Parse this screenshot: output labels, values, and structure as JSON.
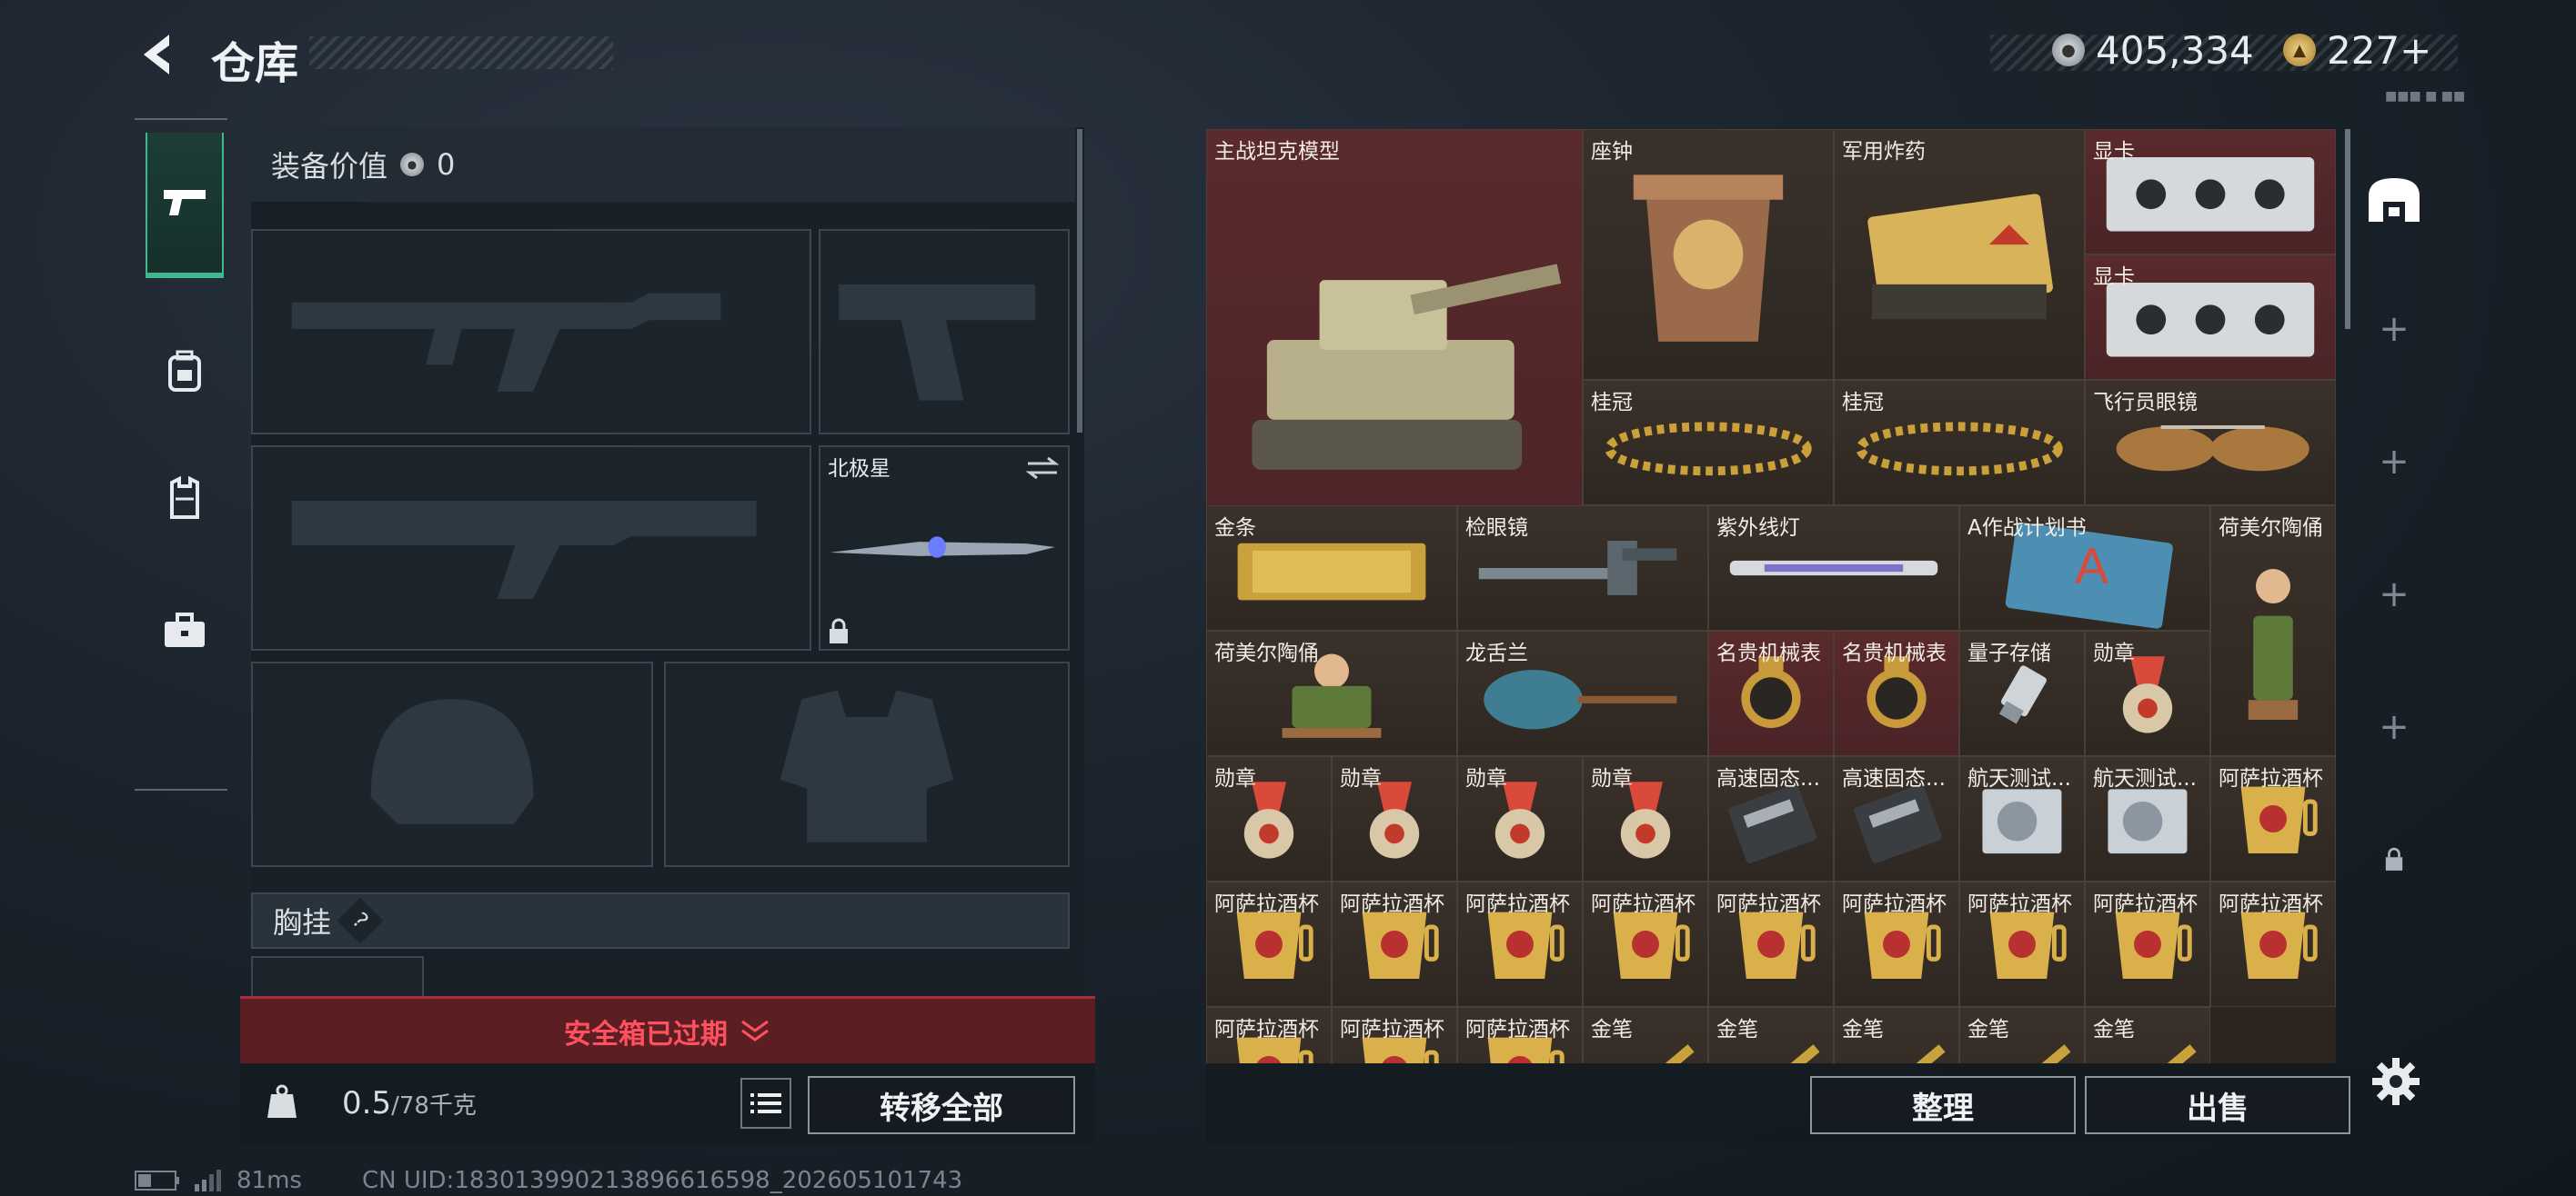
{
  "header": {
    "title": "仓库",
    "silver_amount": "405,334",
    "gold_amount": "227+",
    "sub_label": "■■■ ■ ■■"
  },
  "loadout": {
    "value_label": "装备价值",
    "value_amount": "0",
    "knife_name": "北极星",
    "chest_label": "胸挂",
    "help_mark": "?"
  },
  "safebox": {
    "status": "安全箱已过期"
  },
  "footer": {
    "weight_current": "0.5",
    "weight_max": "/78千克",
    "transfer_all": "转移全部",
    "sort": "整理",
    "sell": "出售",
    "ping": "81ms",
    "uid": "CN UID:18301399021389661659​8_202605101743"
  },
  "items": [
    {
      "name": "主战坦克模型",
      "icon": "tank-icon",
      "rarity": "red"
    },
    {
      "name": "座钟",
      "icon": "clock-icon",
      "rarity": "brown"
    },
    {
      "name": "军用炸药",
      "icon": "explosive-icon",
      "rarity": "brown"
    },
    {
      "name": "显卡",
      "icon": "gpu-icon",
      "rarity": "red"
    },
    {
      "name": "显卡",
      "icon": "gpu-icon",
      "rarity": "red"
    },
    {
      "name": "桂冠",
      "icon": "laurel-icon",
      "rarity": "brown"
    },
    {
      "name": "桂冠",
      "icon": "laurel-icon",
      "rarity": "brown"
    },
    {
      "name": "飞行员眼镜",
      "icon": "sunglasses-icon",
      "rarity": "brown"
    },
    {
      "name": "金条",
      "icon": "gold-bar-icon",
      "rarity": "brown"
    },
    {
      "name": "检眼镜",
      "icon": "ophthalmoscope-icon",
      "rarity": "brown"
    },
    {
      "name": "紫外线灯",
      "icon": "uv-lamp-icon",
      "rarity": "brown"
    },
    {
      "name": "A作战计划书",
      "icon": "plan-book-icon",
      "rarity": "brown"
    },
    {
      "name": "荷美尔陶俑",
      "icon": "figurine-icon",
      "rarity": "brown"
    },
    {
      "name": "荷美尔陶俑",
      "icon": "figurine-icon",
      "rarity": "brown"
    },
    {
      "name": "龙舌兰",
      "icon": "tequila-icon",
      "rarity": "brown"
    },
    {
      "name": "名贵机械表",
      "icon": "watch-icon",
      "rarity": "red"
    },
    {
      "name": "名贵机械表",
      "icon": "watch-icon",
      "rarity": "red"
    },
    {
      "name": "量子存储",
      "icon": "usb-icon",
      "rarity": "brown"
    },
    {
      "name": "勋章",
      "icon": "medal-icon",
      "rarity": "brown"
    },
    {
      "name": "勋章",
      "icon": "medal-icon",
      "rarity": "brown"
    },
    {
      "name": "勋章",
      "icon": "medal-icon",
      "rarity": "brown"
    },
    {
      "name": "勋章",
      "icon": "medal-icon",
      "rarity": "brown"
    },
    {
      "name": "勋章",
      "icon": "medal-icon",
      "rarity": "brown"
    },
    {
      "name": "高速固态...",
      "icon": "ssd-icon",
      "rarity": "brown"
    },
    {
      "name": "高速固态...",
      "icon": "ssd-icon",
      "rarity": "brown"
    },
    {
      "name": "航天测试...",
      "icon": "disk-drive-icon",
      "rarity": "brown"
    },
    {
      "name": "航天测试...",
      "icon": "disk-drive-icon",
      "rarity": "brown"
    },
    {
      "name": "阿萨拉酒杯",
      "icon": "cup-icon",
      "rarity": "brown"
    },
    {
      "name": "阿萨拉酒杯",
      "icon": "cup-icon",
      "rarity": "brown"
    },
    {
      "name": "阿萨拉酒杯",
      "icon": "cup-icon",
      "rarity": "brown"
    },
    {
      "name": "阿萨拉酒杯",
      "icon": "cup-icon",
      "rarity": "brown"
    },
    {
      "name": "阿萨拉酒杯",
      "icon": "cup-icon",
      "rarity": "brown"
    },
    {
      "name": "阿萨拉酒杯",
      "icon": "cup-icon",
      "rarity": "brown"
    },
    {
      "name": "阿萨拉酒杯",
      "icon": "cup-icon",
      "rarity": "brown"
    },
    {
      "name": "阿萨拉酒杯",
      "icon": "cup-icon",
      "rarity": "brown"
    },
    {
      "name": "阿萨拉酒杯",
      "icon": "cup-icon",
      "rarity": "brown"
    },
    {
      "name": "阿萨拉酒杯",
      "icon": "cup-icon",
      "rarity": "brown"
    },
    {
      "name": "阿萨拉酒杯",
      "icon": "cup-icon",
      "rarity": "brown"
    },
    {
      "name": "阿萨拉酒杯",
      "icon": "cup-icon",
      "rarity": "brown"
    },
    {
      "name": "阿萨拉酒杯",
      "icon": "cup-icon",
      "rarity": "brown"
    },
    {
      "name": "金笔",
      "icon": "pen-icon",
      "rarity": "brown"
    },
    {
      "name": "金笔",
      "icon": "pen-icon",
      "rarity": "brown"
    },
    {
      "name": "金笔",
      "icon": "pen-icon",
      "rarity": "brown"
    },
    {
      "name": "金笔",
      "icon": "pen-icon",
      "rarity": "brown"
    },
    {
      "name": "金笔",
      "icon": "pen-icon",
      "rarity": "brown"
    }
  ]
}
